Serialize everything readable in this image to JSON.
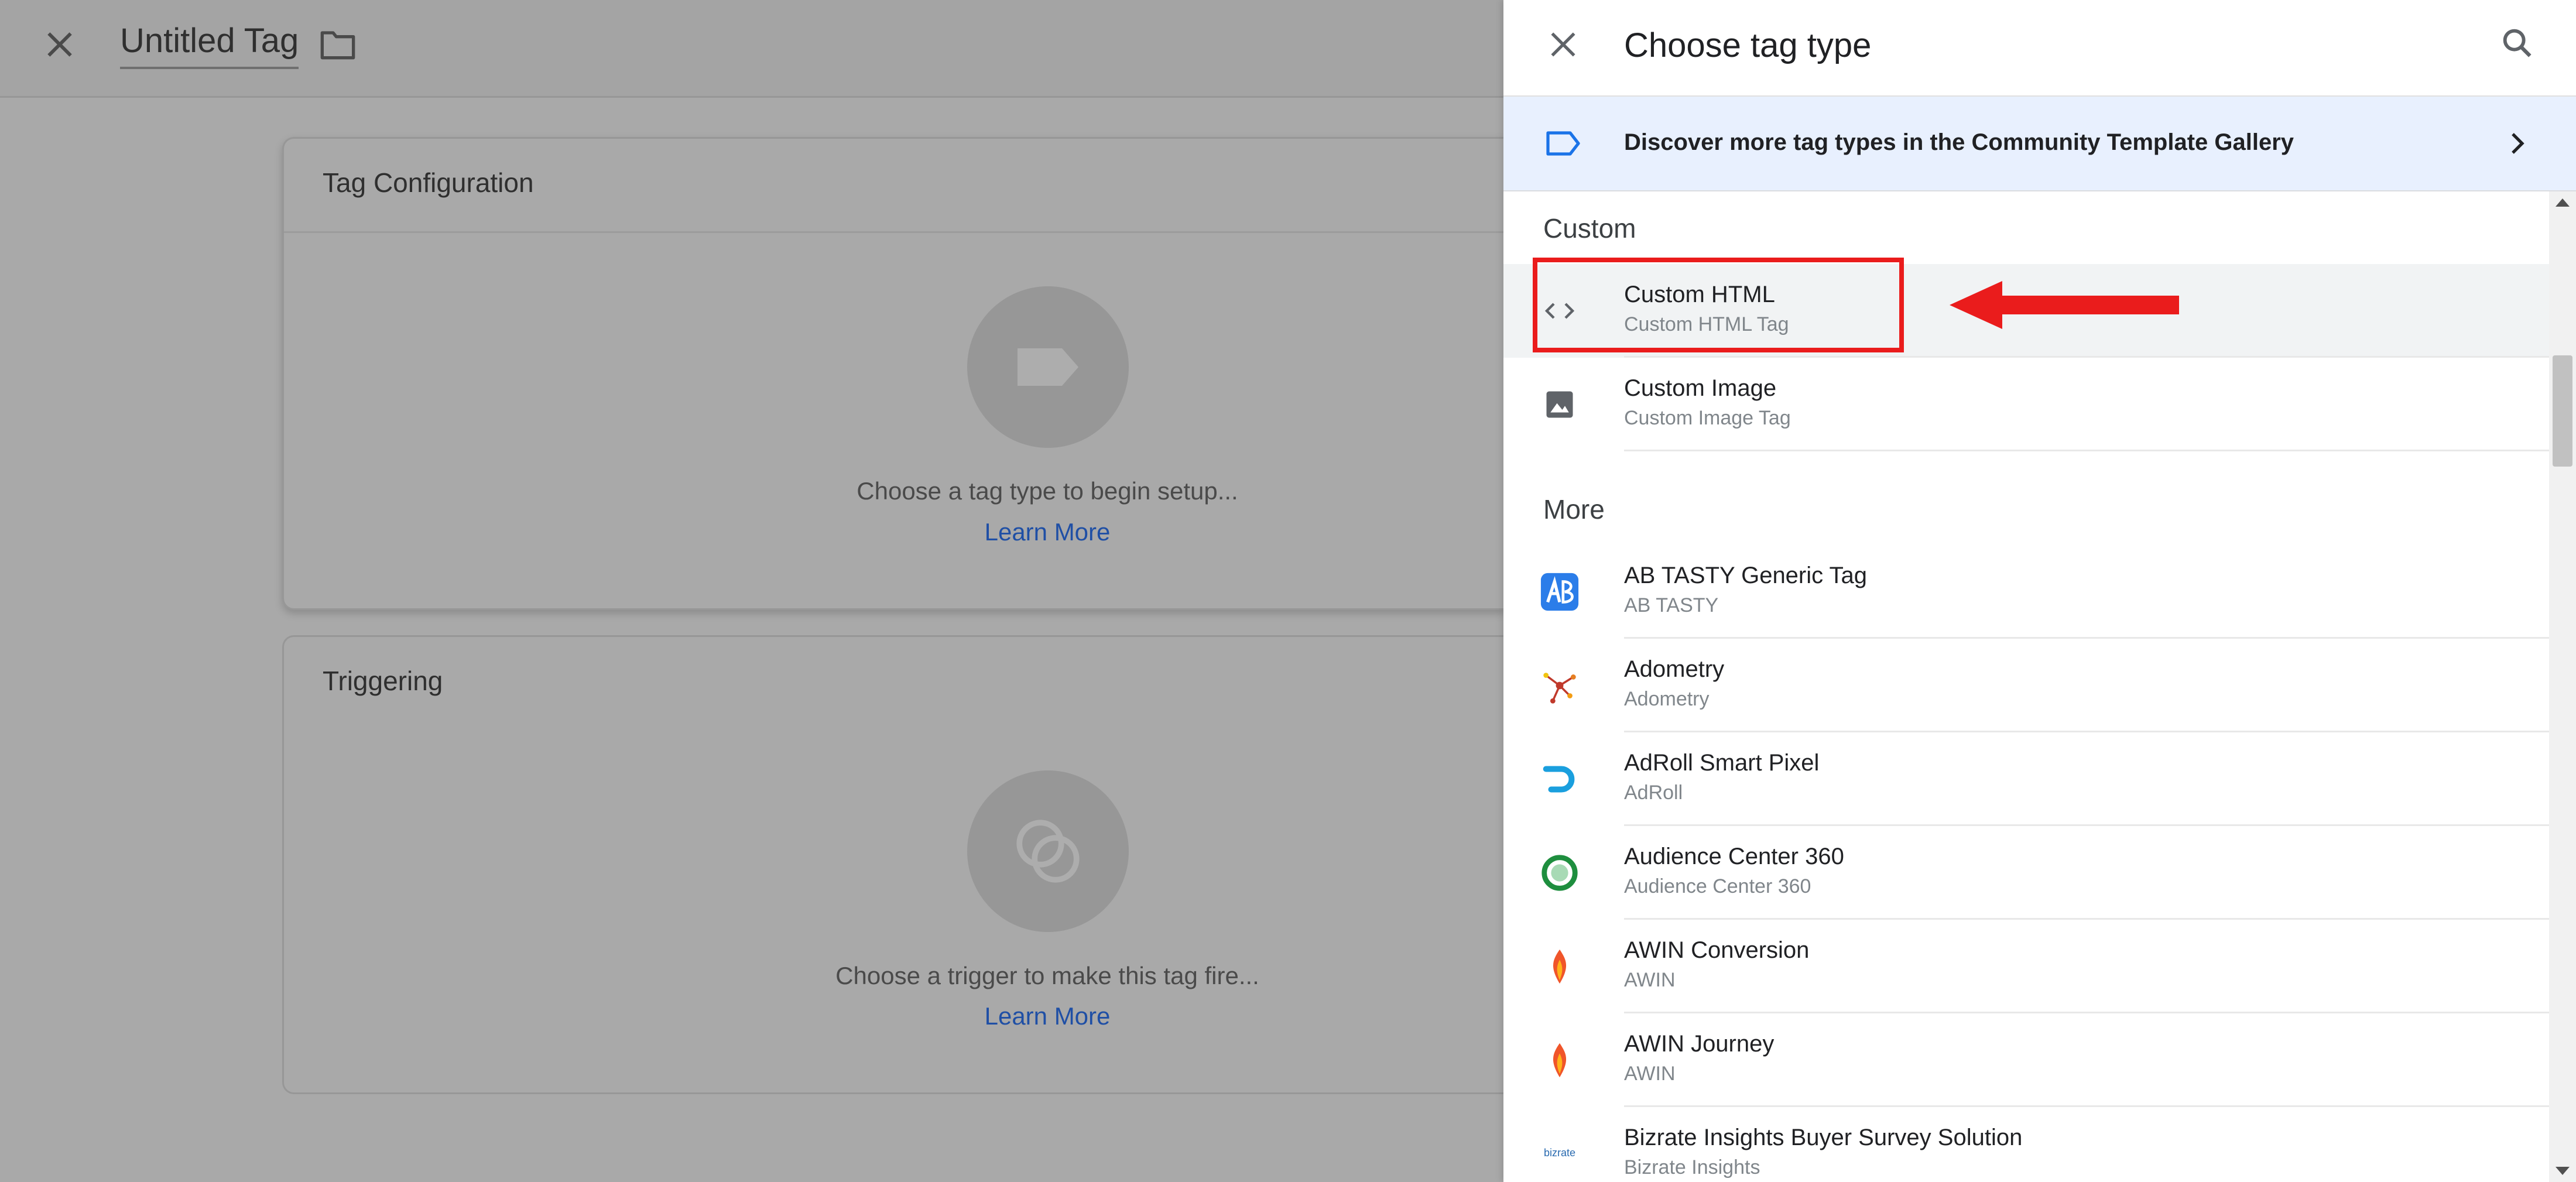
{
  "editor": {
    "tag_title": "Untitled Tag",
    "tag_configuration": {
      "title": "Tag Configuration",
      "hint": "Choose a tag type to begin setup...",
      "link": "Learn More"
    },
    "triggering": {
      "title": "Triggering",
      "hint": "Choose a trigger to make this tag fire...",
      "link": "Learn More"
    }
  },
  "drawer": {
    "title": "Choose tag type",
    "banner": {
      "text": "Discover more tag types in the Community Template Gallery",
      "icon": "tag-outline-icon"
    },
    "sections": [
      {
        "title": "Custom",
        "items": [
          {
            "name": "Custom HTML",
            "subtitle": "Custom HTML Tag",
            "icon": "code-icon",
            "selected": true
          },
          {
            "name": "Custom Image",
            "subtitle": "Custom Image Tag",
            "icon": "image-icon",
            "selected": false
          }
        ]
      },
      {
        "title": "More",
        "items": [
          {
            "name": "AB TASTY Generic Tag",
            "subtitle": "AB TASTY",
            "icon": "abtasty-logo-icon"
          },
          {
            "name": "Adometry",
            "subtitle": "Adometry",
            "icon": "adometry-logo-icon"
          },
          {
            "name": "AdRoll Smart Pixel",
            "subtitle": "AdRoll",
            "icon": "adroll-logo-icon"
          },
          {
            "name": "Audience Center 360",
            "subtitle": "Audience Center 360",
            "icon": "audience-center-logo-icon"
          },
          {
            "name": "AWIN Conversion",
            "subtitle": "AWIN",
            "icon": "awin-logo-icon"
          },
          {
            "name": "AWIN Journey",
            "subtitle": "AWIN",
            "icon": "awin-logo-icon"
          },
          {
            "name": "Bizrate Insights Buyer Survey Solution",
            "subtitle": "Bizrate Insights",
            "icon": "bizrate-logo-icon",
            "logo_text": "bizrate"
          }
        ]
      }
    ]
  },
  "colors": {
    "accent_link": "#1f4fa5",
    "banner_bg": "#e8f0fe",
    "annotation_red": "#ea1c1c"
  }
}
